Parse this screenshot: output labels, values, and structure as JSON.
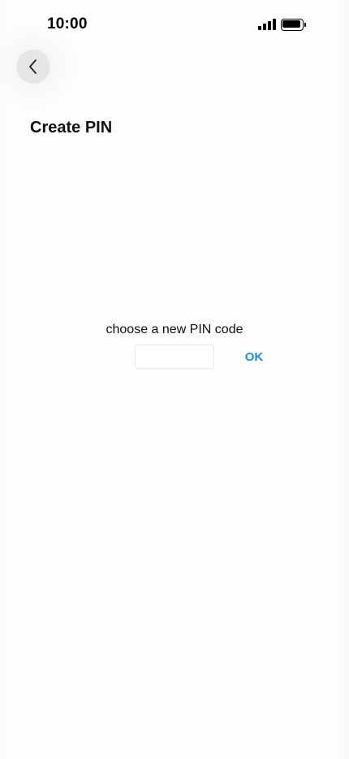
{
  "status_bar": {
    "time": "10:00",
    "icons": [
      "cellular-signal-icon",
      "battery-icon"
    ]
  },
  "navigation": {
    "back_icon": "chevron-left-icon"
  },
  "header": {
    "title": "Create PIN"
  },
  "form": {
    "prompt": "choose a new PIN code",
    "pin_value": "",
    "pin_placeholder": "",
    "ok_label": "OK"
  },
  "colors": {
    "accent": "#1a8fd8",
    "back_button_bg": "#e6e6e6",
    "background": "#fdfdfd"
  }
}
